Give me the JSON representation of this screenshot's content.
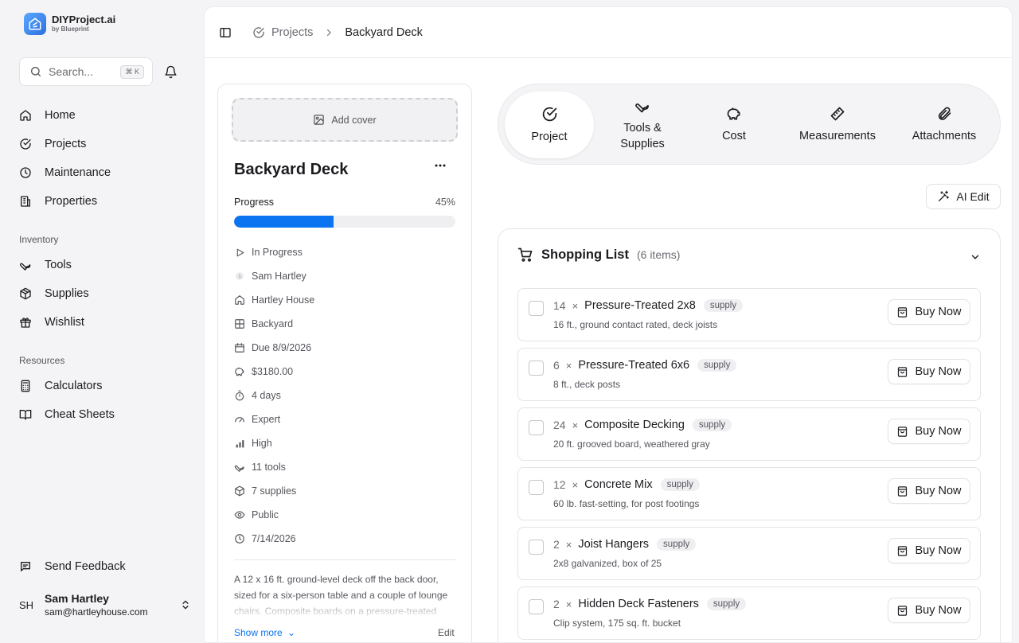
{
  "brand": {
    "name": "DIYProject.ai",
    "sub": "by Blueprint"
  },
  "search": {
    "placeholder": "Search...",
    "shortcut": "⌘ K"
  },
  "nav": {
    "main": [
      {
        "label": "Home",
        "icon": "home-icon"
      },
      {
        "label": "Projects",
        "icon": "check-circle-icon"
      },
      {
        "label": "Maintenance",
        "icon": "clock-icon"
      },
      {
        "label": "Properties",
        "icon": "building-icon"
      }
    ],
    "inventory_title": "Inventory",
    "inventory": [
      {
        "label": "Tools",
        "icon": "wrench-icon"
      },
      {
        "label": "Supplies",
        "icon": "package-icon"
      },
      {
        "label": "Wishlist",
        "icon": "gift-icon"
      }
    ],
    "resources_title": "Resources",
    "resources": [
      {
        "label": "Calculators",
        "icon": "calculator-icon"
      },
      {
        "label": "Cheat Sheets",
        "icon": "book-icon"
      }
    ],
    "feedback": "Send Feedback"
  },
  "user": {
    "initials": "SH",
    "name": "Sam Hartley",
    "email": "sam@hartleyhouse.com"
  },
  "breadcrumb": {
    "parent": "Projects",
    "current": "Backyard Deck"
  },
  "project": {
    "add_cover": "Add cover",
    "title": "Backyard Deck",
    "progress_label": "Progress",
    "progress_text": "45%",
    "progress": 45,
    "meta": [
      {
        "icon": "play-icon",
        "text": "In Progress"
      },
      {
        "icon": "user-dot-icon",
        "text": "Sam Hartley"
      },
      {
        "icon": "house-icon",
        "text": "Hartley House"
      },
      {
        "icon": "grid-icon",
        "text": "Backyard"
      },
      {
        "icon": "calendar-icon",
        "text": "Due 8/9/2026"
      },
      {
        "icon": "piggy-bank-icon",
        "text": "$3180.00"
      },
      {
        "icon": "timer-icon",
        "text": "4 days"
      },
      {
        "icon": "gauge-icon",
        "text": "Expert"
      },
      {
        "icon": "bar-chart-icon",
        "text": "High"
      },
      {
        "icon": "wrench-icon",
        "text": "11 tools"
      },
      {
        "icon": "package-icon",
        "text": "7 supplies"
      },
      {
        "icon": "eye-icon",
        "text": "Public"
      },
      {
        "icon": "clock-icon",
        "text": "7/14/2026"
      }
    ],
    "description": "A 12 x 16 ft. ground-level deck off the back door, sized for a six-person table and a couple of lounge chairs. Composite boards on a pressure-treated",
    "show_more": "Show more",
    "edit": "Edit"
  },
  "tabs": [
    {
      "label": "Project",
      "icon": "check-circle-icon",
      "active": true
    },
    {
      "label": "Tools & Supplies",
      "icon": "wrench-icon",
      "active": false
    },
    {
      "label": "Cost",
      "icon": "piggy-bank-icon",
      "active": false
    },
    {
      "label": "Measurements",
      "icon": "ruler-icon",
      "active": false
    },
    {
      "label": "Attachments",
      "icon": "paperclip-icon",
      "active": false
    }
  ],
  "ai_edit": "AI Edit",
  "shopping": {
    "title": "Shopping List",
    "count": "(6 items)",
    "buy_label": "Buy Now",
    "items": [
      {
        "qty": "14",
        "name": "Pressure-Treated 2x8",
        "tag": "supply",
        "desc": "16 ft., ground contact rated, deck joists"
      },
      {
        "qty": "6",
        "name": "Pressure-Treated 6x6",
        "tag": "supply",
        "desc": "8 ft., deck posts"
      },
      {
        "qty": "24",
        "name": "Composite Decking",
        "tag": "supply",
        "desc": "20 ft. grooved board, weathered gray"
      },
      {
        "qty": "12",
        "name": "Concrete Mix",
        "tag": "supply",
        "desc": "60 lb. fast-setting, for post footings"
      },
      {
        "qty": "2",
        "name": "Joist Hangers",
        "tag": "supply",
        "desc": "2x8 galvanized, box of 25"
      },
      {
        "qty": "2",
        "name": "Hidden Deck Fasteners",
        "tag": "supply",
        "desc": "Clip system, 175 sq. ft. bucket"
      }
    ]
  },
  "colors": {
    "accent": "#0b74f0",
    "background": "#f4f4f6",
    "border": "#e6e6ea"
  }
}
